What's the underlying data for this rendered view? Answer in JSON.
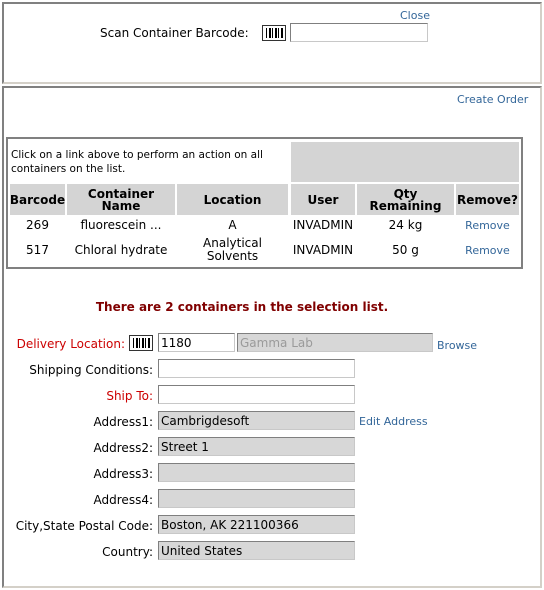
{
  "top": {
    "close_label": "Close",
    "scan_label": "Scan Container Barcode:",
    "scan_value": ""
  },
  "create_order_label": "Create Order",
  "list": {
    "hint": "Click on a link above to perform an action on all containers on the list.",
    "columns": [
      "Barcode",
      "Container Name",
      "Location",
      "User",
      "Qty Remaining",
      "Remove?"
    ],
    "rows": [
      {
        "barcode": "269",
        "name": "fluorescein ...",
        "location": "A",
        "user": "INVADMIN",
        "qty": "24 kg",
        "remove": "Remove"
      },
      {
        "barcode": "517",
        "name": "Chloral hydrate",
        "location": "Analytical Solvents",
        "user": "INVADMIN",
        "qty": "50 g",
        "remove": "Remove"
      }
    ]
  },
  "message": "There are 2 containers in the selection list.",
  "form": {
    "delivery_location_label": "Delivery Location:",
    "delivery_location_id": "1180",
    "delivery_location_name": "Gamma Lab",
    "browse_label": "Browse",
    "shipping_conditions_label": "Shipping Conditions:",
    "shipping_conditions_value": "",
    "ship_to_label": "Ship To:",
    "ship_to_value": "",
    "address1_label": "Address1:",
    "address1_value": "Cambrigdesoft",
    "edit_address_label": "Edit Address",
    "address2_label": "Address2:",
    "address2_value": "Street 1",
    "address3_label": "Address3:",
    "address3_value": "",
    "address4_label": "Address4:",
    "address4_value": "",
    "city_label": "City,State Postal Code:",
    "city_value": "Boston, AK 221100366",
    "country_label": "Country:",
    "country_value": "United States"
  },
  "colors": {
    "header_bg": "#d4d4d4",
    "readonly_bg": "#d7d7d7",
    "required_label": "#cc0000",
    "message": "#800000",
    "link": "#336699"
  }
}
